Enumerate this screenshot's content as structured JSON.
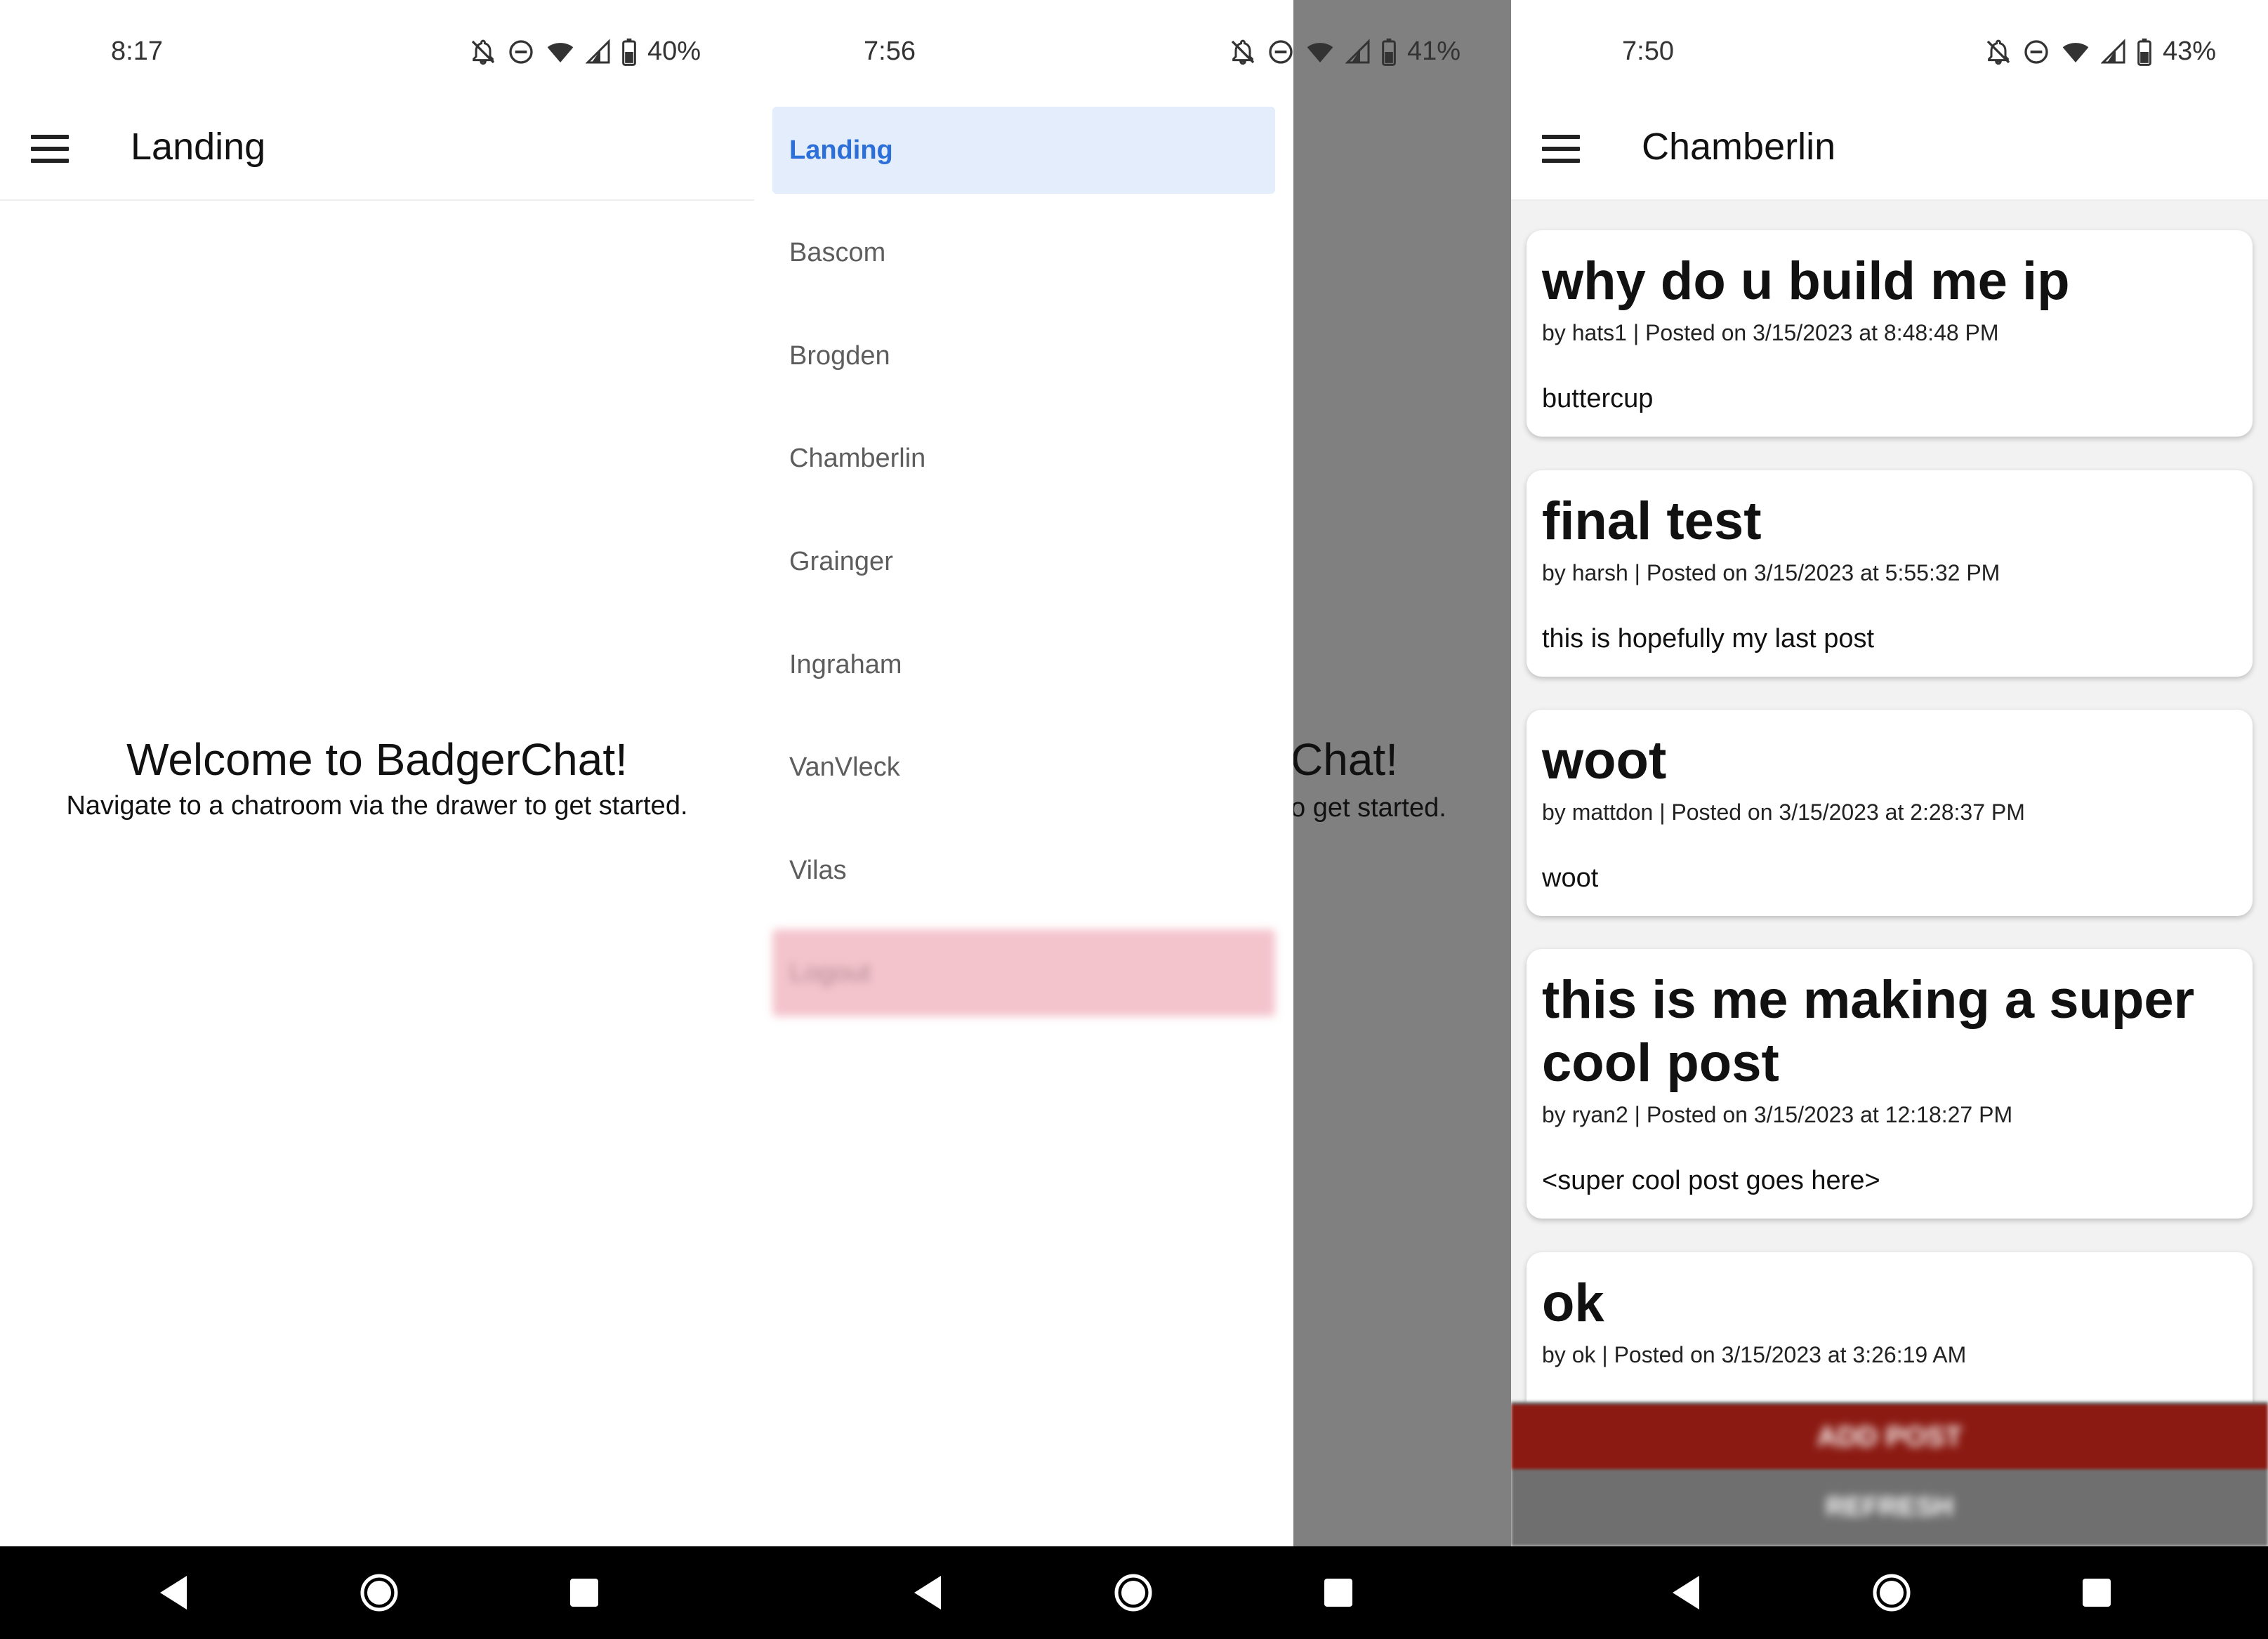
{
  "screens": {
    "landing": {
      "status": {
        "time": "8:17",
        "battery": "40%"
      },
      "title": "Landing",
      "welcome_title": "Welcome to BadgerChat!",
      "welcome_subtitle": "Navigate to a chatroom via the drawer to get started."
    },
    "drawer": {
      "status": {
        "time": "7:56",
        "battery": "41%"
      },
      "items": [
        "Landing",
        "Bascom",
        "Brogden",
        "Chamberlin",
        "Grainger",
        "Ingraham",
        "VanVleck",
        "Vilas",
        "Logout"
      ],
      "active": "Landing",
      "behind_title": "Chat!",
      "behind_subtitle": "o get started."
    },
    "chamberlin": {
      "status": {
        "time": "7:50",
        "battery": "43%"
      },
      "title": "Chamberlin",
      "posts": [
        {
          "title": "why do u build me ip",
          "meta": "by hats1 | Posted on 3/15/2023 at 8:48:48 PM",
          "body": "buttercup"
        },
        {
          "title": "final test",
          "meta": "by harsh | Posted on 3/15/2023 at 5:55:32 PM",
          "body": "this is hopefully my last post"
        },
        {
          "title": "woot",
          "meta": "by mattdon | Posted on 3/15/2023 at 2:28:37 PM",
          "body": "woot"
        },
        {
          "title": "this is me making a super cool post",
          "meta": "by ryan2 | Posted on 3/15/2023 at 12:18:27 PM",
          "body": "<super cool post goes here>"
        },
        {
          "title": "ok",
          "meta": "by ok | Posted on 3/15/2023 at 3:26:19 AM",
          "body": ""
        }
      ],
      "add_post_label": "ADD POST",
      "refresh_label": "REFRESH"
    }
  },
  "colors": {
    "active_bg": "#e3edfb",
    "active_text": "#2c6fd8",
    "logout_bg": "#f4c4cd",
    "add_post_bg": "#8b1a12"
  }
}
